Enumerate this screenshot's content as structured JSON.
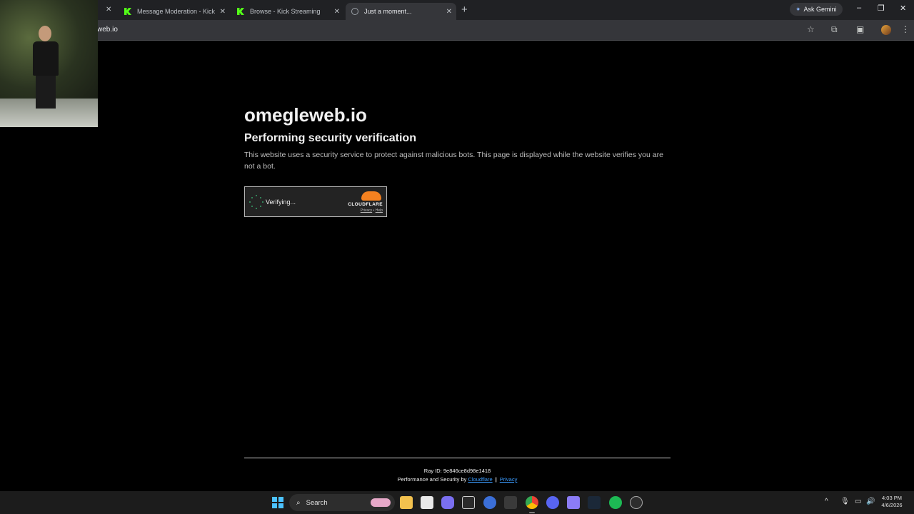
{
  "browser": {
    "tabs": [
      {
        "title": "Message Moderation - Kick Da",
        "favicon": "kick-icon"
      },
      {
        "title": "Browse - Kick Streaming",
        "favicon": "kick-icon"
      },
      {
        "title": "Just a moment...",
        "favicon": "globe-icon",
        "active": true
      }
    ],
    "new_tab": "+",
    "close_glyph": "✕",
    "ask_gemini": "Ask Gemini",
    "url": "web.io"
  },
  "page": {
    "site_name": "omegleweb.io",
    "heading": "Performing security verification",
    "description": "This website uses a security service to protect against malicious bots. This page is displayed while the website verifies you are not a bot.",
    "widget": {
      "status": "Verifying...",
      "brand": "CLOUDFLARE",
      "privacy": "Privacy",
      "dot": " • ",
      "help": "Help"
    },
    "footer": {
      "ray_id": "Ray ID: 9e846ce8d98e1418",
      "perf_prefix": "Performance and Security by ",
      "cloudflare_link": "Cloudflare",
      "separator": "|",
      "privacy_link": "Privacy"
    }
  },
  "taskbar": {
    "search_label": "Search",
    "time": "4:03 PM",
    "date": "4/6/2026"
  },
  "colors": {
    "page_bg": "#000000",
    "spinner": "#38a169",
    "cloudflare_orange": "#f48120",
    "link": "#3b9cff"
  }
}
